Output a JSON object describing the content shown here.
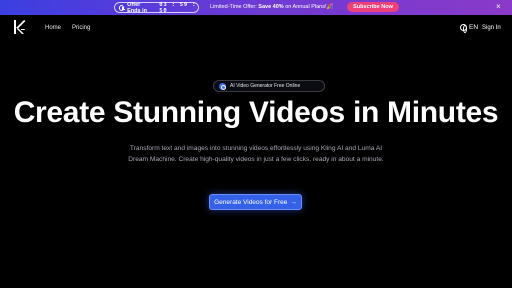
{
  "promo": {
    "offer_label": "Offer Ends in",
    "timer": "03 : 59 : 50",
    "message_prefix": "Limited-Time Offer: ",
    "message_bold": "Save 40%",
    "message_suffix": " on Annual Plans!🎉",
    "subscribe_label": "Subscribe Now",
    "close_glyph": "×",
    "colors": {
      "bar_start": "#3b3fe0",
      "bar_end": "#8a3ac8",
      "subscribe_bg": "#f0407a"
    }
  },
  "nav": {
    "links": [
      "Home",
      "Pricing"
    ],
    "language": "EN",
    "signin_label": "Sign In",
    "logo_icon": "k-logo-icon"
  },
  "hero": {
    "badge_text": "AI Video Generator Free Online",
    "headline": "Create Stunning Videos in Minutes",
    "description": "Transform text and images into stunning videos effortlessly using Kling AI and Luma AI Dream Machine. Create high-quality videos in just a few clicks, ready in about a minute.",
    "cta_label": "Generate Videos for Free",
    "cta_arrow": "→",
    "colors": {
      "cta_bg": "#3461e8",
      "background": "#000000",
      "desc_text": "#a8a8b4"
    }
  }
}
